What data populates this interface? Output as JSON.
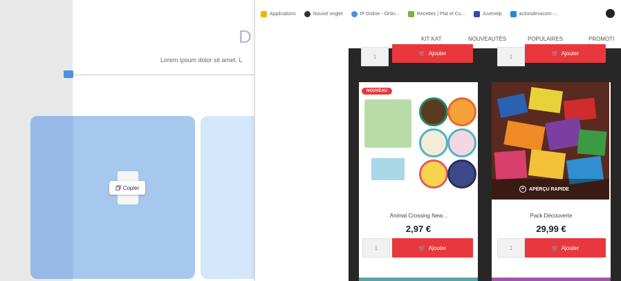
{
  "editor": {
    "heading_letter": "D",
    "lorem": "Lorem ipsum dolor sit amet. L",
    "copy_label": "Copier"
  },
  "browser": {
    "bookmarks": [
      {
        "label": "Applications",
        "color": "#f0b400"
      },
      {
        "label": "Nouvel onglet",
        "color": "#333333"
      },
      {
        "label": "IP Online - Onlin...",
        "color": "#4a90e2"
      },
      {
        "label": "Recettes | Plat et Cu...",
        "color": "#7cb342"
      },
      {
        "label": "Juvenelp",
        "color": "#3949ab"
      },
      {
        "label": "actiondevacom -...",
        "color": "#1e88e5"
      }
    ],
    "nav": [
      "KIT KAT",
      "NOUVEAUTÉS",
      "POPULAIRES",
      "PROMOTI"
    ],
    "add_label": "Ajouter",
    "qty_default": "1",
    "products": [
      {
        "title": "Animal Crossing New...",
        "price": "2,97 €",
        "badge": "NOUVEAU"
      },
      {
        "title": "Pack Découverte",
        "price": "29,99 €",
        "overlay": "APERÇU RAPIDE"
      }
    ]
  },
  "colors": {
    "accent_red": "#e8383d",
    "editor_blue": "#a6c8ee",
    "dark_page": "#272727"
  }
}
